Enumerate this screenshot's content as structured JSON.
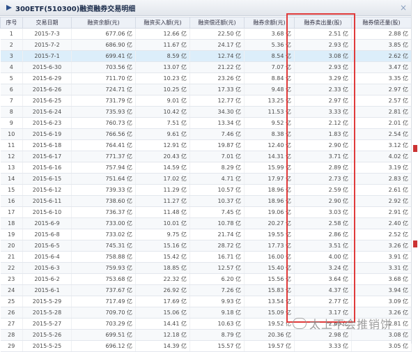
{
  "title": "300ETF(510300)融资融券交易明细",
  "columns": [
    "序号",
    "交易日期",
    "融资余额(元)",
    "融资买入额(元)",
    "融资偿还额(元)",
    "融券余额(元)",
    "融券卖出量(股)",
    "融券偿还量(股)"
  ],
  "rows": [
    [
      "1",
      "2015-7-3",
      "677.06 亿",
      "12.66 亿",
      "22.50 亿",
      "3.68 亿",
      "2.51 亿",
      "2.88 亿"
    ],
    [
      "2",
      "2015-7-2",
      "686.90 亿",
      "11.67 亿",
      "24.17 亿",
      "5.36 亿",
      "2.93 亿",
      "3.85 亿"
    ],
    [
      "3",
      "2015-7-1",
      "699.41 亿",
      "8.59 亿",
      "12.74 亿",
      "8.54 亿",
      "3.08 亿",
      "2.62 亿"
    ],
    [
      "4",
      "2015-6-30",
      "703.56 亿",
      "13.07 亿",
      "21.22 亿",
      "7.07 亿",
      "2.93 亿",
      "3.47 亿"
    ],
    [
      "5",
      "2015-6-29",
      "711.70 亿",
      "10.23 亿",
      "23.26 亿",
      "8.84 亿",
      "3.29 亿",
      "3.35 亿"
    ],
    [
      "6",
      "2015-6-26",
      "724.71 亿",
      "10.25 亿",
      "17.33 亿",
      "9.48 亿",
      "2.33 亿",
      "2.97 亿"
    ],
    [
      "7",
      "2015-6-25",
      "731.79 亿",
      "9.01 亿",
      "12.77 亿",
      "13.25 亿",
      "2.97 亿",
      "2.57 亿"
    ],
    [
      "8",
      "2015-6-24",
      "735.93 亿",
      "10.42 亿",
      "34.30 亿",
      "11.53 亿",
      "3.33 亿",
      "2.81 亿"
    ],
    [
      "9",
      "2015-6-23",
      "760.73 亿",
      "7.51 亿",
      "13.34 亿",
      "9.52 亿",
      "2.12 亿",
      "2.01 亿"
    ],
    [
      "10",
      "2015-6-19",
      "766.56 亿",
      "9.61 亿",
      "7.46 亿",
      "8.38 亿",
      "1.83 亿",
      "2.54 亿"
    ],
    [
      "11",
      "2015-6-18",
      "764.41 亿",
      "12.91 亿",
      "19.87 亿",
      "12.40 亿",
      "2.90 亿",
      "3.12 亿"
    ],
    [
      "12",
      "2015-6-17",
      "771.37 亿",
      "20.43 亿",
      "7.01 亿",
      "14.31 亿",
      "3.71 亿",
      "4.02 亿"
    ],
    [
      "13",
      "2015-6-16",
      "757.94 亿",
      "14.59 亿",
      "8.29 亿",
      "15.99 亿",
      "2.89 亿",
      "3.19 亿"
    ],
    [
      "14",
      "2015-6-15",
      "751.64 亿",
      "17.02 亿",
      "4.71 亿",
      "17.97 亿",
      "2.73 亿",
      "2.83 亿"
    ],
    [
      "15",
      "2015-6-12",
      "739.33 亿",
      "11.29 亿",
      "10.57 亿",
      "18.96 亿",
      "2.59 亿",
      "2.61 亿"
    ],
    [
      "16",
      "2015-6-11",
      "738.60 亿",
      "11.27 亿",
      "10.37 亿",
      "18.96 亿",
      "2.90 亿",
      "2.92 亿"
    ],
    [
      "17",
      "2015-6-10",
      "736.37 亿",
      "11.48 亿",
      "7.45 亿",
      "19.06 亿",
      "3.03 亿",
      "2.91 亿"
    ],
    [
      "18",
      "2015-6-9",
      "733.00 亿",
      "10.01 亿",
      "10.78 亿",
      "20.27 亿",
      "2.58 亿",
      "2.40 亿"
    ],
    [
      "19",
      "2015-6-8",
      "733.02 亿",
      "9.75 亿",
      "21.74 亿",
      "19.55 亿",
      "2.86 亿",
      "2.52 亿"
    ],
    [
      "20",
      "2015-6-5",
      "745.31 亿",
      "15.16 亿",
      "28.72 亿",
      "17.73 亿",
      "3.51 亿",
      "3.26 亿"
    ],
    [
      "21",
      "2015-6-4",
      "758.88 亿",
      "15.42 亿",
      "16.71 亿",
      "16.00 亿",
      "4.00 亿",
      "3.91 亿"
    ],
    [
      "22",
      "2015-6-3",
      "759.93 亿",
      "18.85 亿",
      "12.57 亿",
      "15.40 亿",
      "3.24 亿",
      "3.31 亿"
    ],
    [
      "23",
      "2015-6-2",
      "753.68 亿",
      "22.32 亿",
      "6.20 亿",
      "15.56 亿",
      "3.64 亿",
      "3.68 亿"
    ],
    [
      "24",
      "2015-6-1",
      "737.67 亿",
      "26.92 亿",
      "7.26 亿",
      "15.83 亿",
      "4.37 亿",
      "3.94 亿"
    ],
    [
      "25",
      "2015-5-29",
      "717.49 亿",
      "17.69 亿",
      "9.93 亿",
      "13.54 亿",
      "2.77 亿",
      "3.09 亿"
    ],
    [
      "26",
      "2015-5-28",
      "709.70 亿",
      "15.06 亿",
      "9.18 亿",
      "15.09 亿",
      "3.17 亿",
      "3.26 亿"
    ],
    [
      "27",
      "2015-5-27",
      "703.29 亿",
      "14.41 亿",
      "10.63 亿",
      "19.52 亿",
      "2.65 亿",
      "2.81 亿"
    ],
    [
      "28",
      "2015-5-26",
      "699.51 亿",
      "12.18 亿",
      "8.79 亿",
      "20.36 亿",
      "2.98 亿",
      "3.08 亿"
    ],
    [
      "29",
      "2015-5-25",
      "696.12 亿",
      "14.39 亿",
      "15.57 亿",
      "19.57 亿",
      "3.33 亿",
      "3.05 亿"
    ]
  ],
  "watermark": "太上不会推销饼",
  "left_watermark": "太上不会推销饼",
  "accent_red": "#e03a3a",
  "highlight_row_color": "#dceefa"
}
